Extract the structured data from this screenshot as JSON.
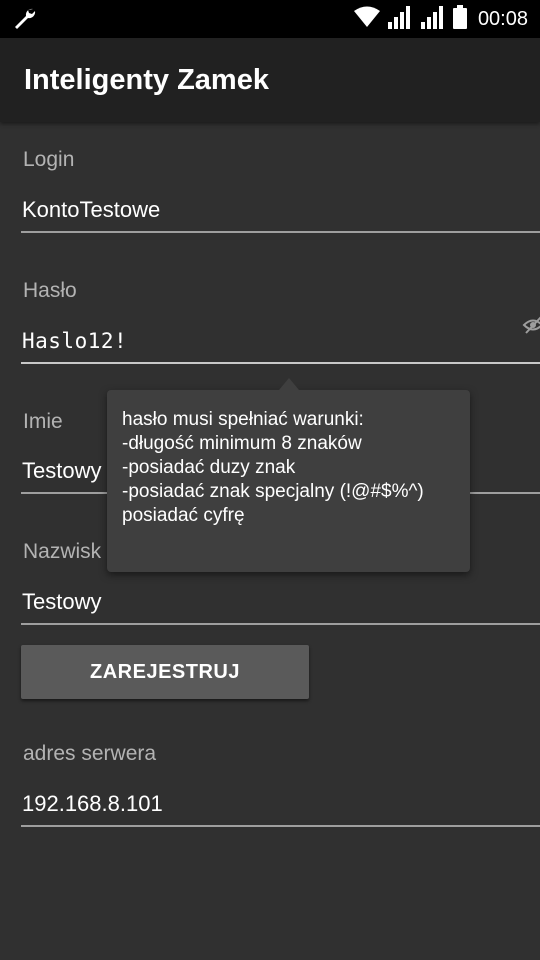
{
  "status_bar": {
    "time": "00:08",
    "icons": [
      "wrench-icon",
      "wifi-icon",
      "signal-icon",
      "signal-icon",
      "battery-icon"
    ]
  },
  "app_bar": {
    "title": "Inteligenty Zamek"
  },
  "form": {
    "login_label": "Login",
    "login_value": "KontoTestowe",
    "password_label": "Hasło",
    "password_value": "Haslo12!",
    "name_label": "Imie",
    "name_value": "Testowy",
    "surname_label": "Nazwisk",
    "surname_value": "Testowy",
    "register_button": "ZAREJESTRUJ",
    "server_label": "adres serwera",
    "server_value": "192.168.8.101"
  },
  "tooltip": {
    "lines": [
      "hasło musi spełniać warunki:",
      "-długość minimum 8 znaków",
      "-posiadać duzy znak",
      "-posiadać znak specjalny (!@#$%^)",
      "posiadać cyfrę"
    ]
  },
  "colors": {
    "background": "#303030",
    "app_bar": "#212121",
    "status_bar": "#000000",
    "button": "#5a5a5a",
    "tooltip": "#3f3f3f"
  }
}
